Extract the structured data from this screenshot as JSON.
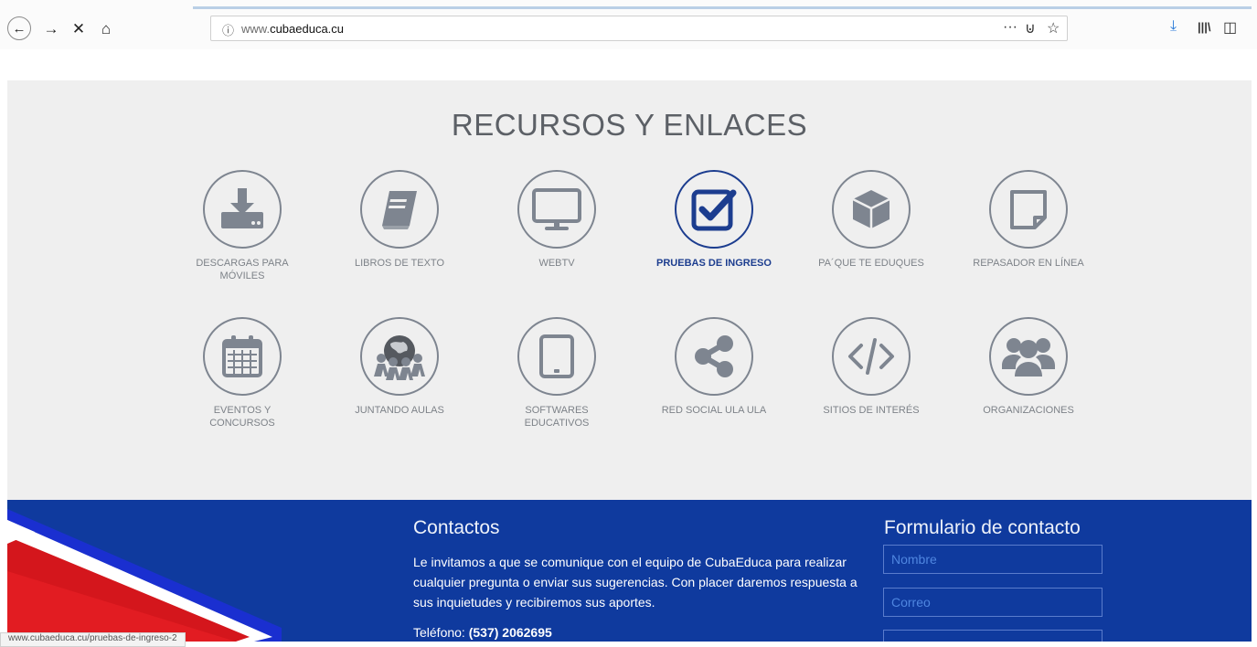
{
  "browser": {
    "url_prefix": "www.",
    "url_domain": "cubaeduca.cu",
    "status_url": "www.cubaeduca.cu/pruebas-de-ingreso-2"
  },
  "resources": {
    "title": "RECURSOS Y ENLACES",
    "row1": [
      {
        "label": "DESCARGAS PARA MÓVILES",
        "icon": "download-icon",
        "active": false
      },
      {
        "label": "LIBROS DE TEXTO",
        "icon": "book-icon",
        "active": false
      },
      {
        "label": "WEBTV",
        "icon": "monitor-icon",
        "active": false
      },
      {
        "label": "PRUEBAS DE INGRESO",
        "icon": "checkbox-icon",
        "active": true
      },
      {
        "label": "PA´QUE TE EDUQUES",
        "icon": "cube-icon",
        "active": false
      },
      {
        "label": "REPASADOR EN LÍNEA",
        "icon": "note-icon",
        "active": false
      }
    ],
    "row2": [
      {
        "label": "EVENTOS Y CONCURSOS",
        "icon": "calendar-icon",
        "active": false
      },
      {
        "label": "JUNTANDO AULAS",
        "icon": "globe-people-icon",
        "active": false
      },
      {
        "label": "SOFTWARES EDUCATIVOS",
        "icon": "tablet-icon",
        "active": false
      },
      {
        "label": "RED SOCIAL ULA ULA",
        "icon": "share-icon",
        "active": false
      },
      {
        "label": "SITIOS DE INTERÉS",
        "icon": "code-icon",
        "active": false
      },
      {
        "label": "ORGANIZACIONES",
        "icon": "group-icon",
        "active": false
      }
    ]
  },
  "footer": {
    "contact_title": "Contactos",
    "contact_text": "Le invitamos a que se comunique con el equipo de CubaEduca para realizar cualquier pregunta o enviar sus sugerencias. Con placer daremos respuesta a sus inquietudes y recibiremos sus aportes.",
    "phone_label": "Teléfono:",
    "phone_value": "(537) 2062695",
    "form_title": "Formulario de contacto",
    "name_placeholder": "Nombre",
    "email_placeholder": "Correo"
  },
  "colors": {
    "footer_bg": "#0f3a9e",
    "active": "#1c3d8f",
    "icon_gray": "#7e8590"
  }
}
